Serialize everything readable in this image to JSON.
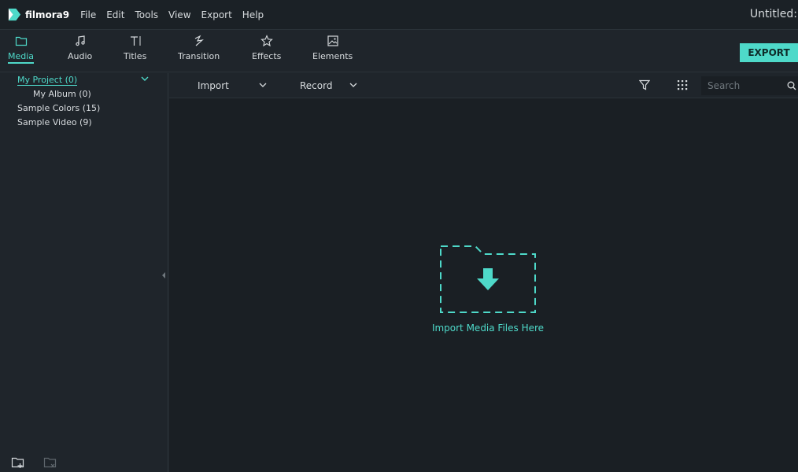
{
  "app": {
    "logo_text": "filmora9",
    "document_title": "Untitled:"
  },
  "menu": [
    "File",
    "Edit",
    "Tools",
    "View",
    "Export",
    "Help"
  ],
  "toolbar": {
    "tools": [
      {
        "label": "Media",
        "icon": "folder-icon"
      },
      {
        "label": "Audio",
        "icon": "music-note-icon"
      },
      {
        "label": "Titles",
        "icon": "text-icon"
      },
      {
        "label": "Transition",
        "icon": "transition-icon"
      },
      {
        "label": "Effects",
        "icon": "effects-icon"
      },
      {
        "label": "Elements",
        "icon": "image-icon"
      }
    ],
    "active_tool": "Media",
    "export_label": "EXPORT"
  },
  "sidebar": {
    "items": [
      {
        "label": "My Project (0)",
        "selected": true
      },
      {
        "label": "My Album (0)"
      },
      {
        "label": "Sample Colors (15)"
      },
      {
        "label": "Sample Video (9)"
      }
    ]
  },
  "media_panel": {
    "import_label": "Import",
    "record_label": "Record",
    "search_placeholder": "Search",
    "drop_zone_label": "Import Media Files Here"
  },
  "colors": {
    "accent": "#4ed9c9",
    "background": "#1f252b",
    "panel": "#1a1f24",
    "text": "#d7dbde"
  }
}
